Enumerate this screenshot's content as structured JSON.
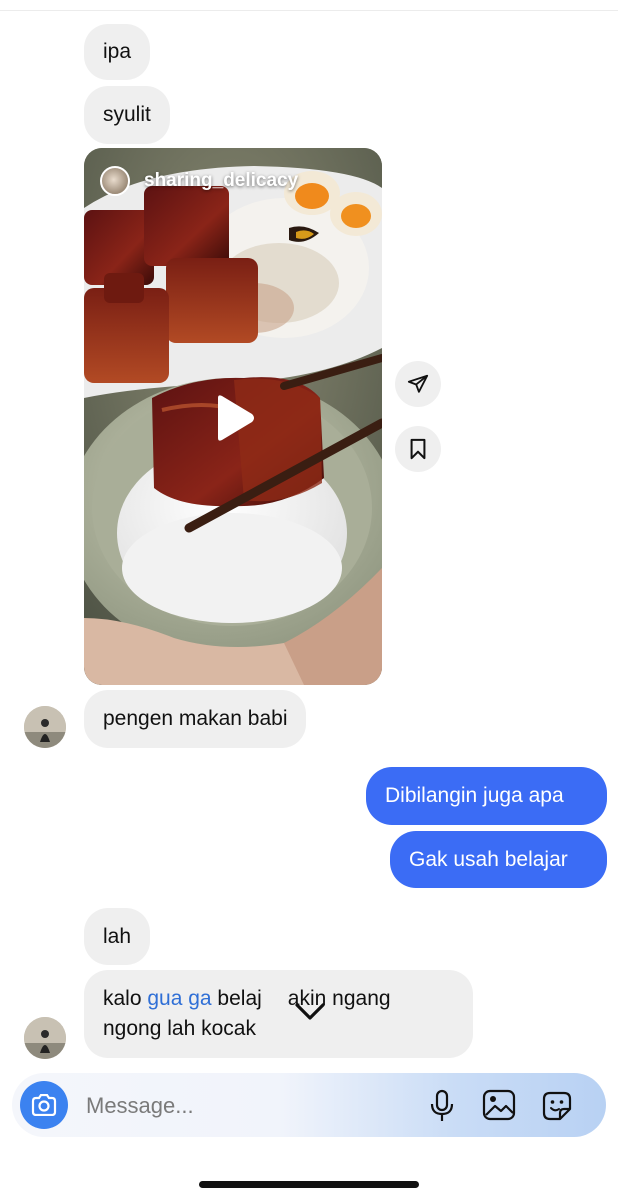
{
  "messages": [
    {
      "text": "ipa"
    },
    {
      "text": "syulit"
    },
    {
      "text": "pengen makan babi"
    },
    {
      "text": "Dibilangin juga apa"
    },
    {
      "text": "Gak usah belajar"
    },
    {
      "text": "lah"
    }
  ],
  "last_message": {
    "part1": "kalo ",
    "highlight": "gua ga",
    "part2": " belaj",
    "part3": "akin ngang",
    "line2": "ngong lah kocak"
  },
  "reel": {
    "username": "sharing_delicacy"
  },
  "composer": {
    "placeholder": "Message..."
  },
  "icons": {
    "share": "paper-plane-icon",
    "save": "bookmark-icon",
    "play": "play-icon",
    "reels": "reels-icon",
    "scroll_down": "chevron-down-icon",
    "camera": "camera-icon",
    "mic": "microphone-icon",
    "gallery": "image-icon",
    "sticker": "sticker-icon"
  },
  "colors": {
    "outgoing_bubble": "#3b6cf5",
    "incoming_bubble": "#efefef",
    "camera_button": "#3b82f0"
  }
}
